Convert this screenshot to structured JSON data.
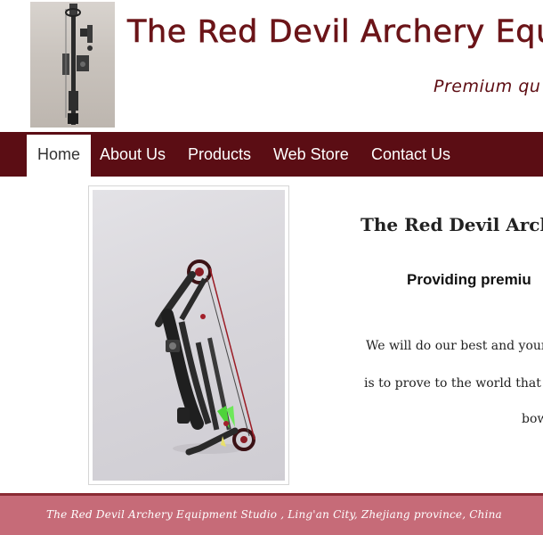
{
  "header": {
    "title": "The Red Devil Archery Equ",
    "tagline": "Premium qu"
  },
  "nav": {
    "items": [
      {
        "label": "Home"
      },
      {
        "label": "About Us"
      },
      {
        "label": "Products"
      },
      {
        "label": "Web Store"
      },
      {
        "label": "Contact Us"
      }
    ],
    "active": "Home"
  },
  "main": {
    "heading": "The Red Devil Arch",
    "subheading": "Providing premiu",
    "lines": [
      "We will do our best and your",
      "is to prove to the world that C",
      "bow"
    ]
  },
  "footer": {
    "text": "The Red Devil Archery Equipment Studio , Ling'an City, Zhejiang province, China"
  },
  "colors": {
    "brand": "#5b0d14",
    "title": "#6b1418",
    "footer": "#c66b78"
  },
  "icons": {
    "logo": "bow-logo-icon",
    "photo": "compound-bow-photo"
  }
}
